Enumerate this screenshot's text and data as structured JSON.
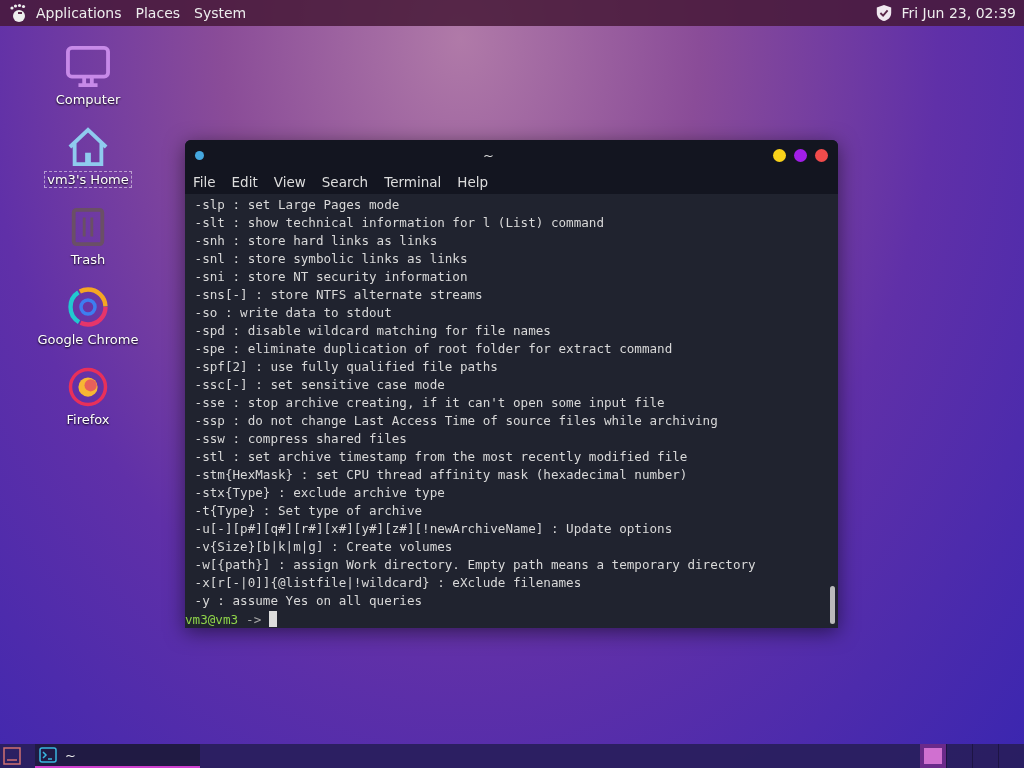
{
  "top_panel": {
    "menus": [
      "Applications",
      "Places",
      "System"
    ],
    "clock": "Fri Jun 23, 02:39"
  },
  "desktop_icons": [
    {
      "kind": "computer",
      "label": "Computer",
      "selected": false
    },
    {
      "kind": "home",
      "label": "vm3's Home",
      "selected": true
    },
    {
      "kind": "trash",
      "label": "Trash",
      "selected": false
    },
    {
      "kind": "chrome",
      "label": "Google Chrome",
      "selected": false
    },
    {
      "kind": "firefox",
      "label": "Firefox",
      "selected": false
    }
  ],
  "terminal": {
    "title": "~",
    "menu": [
      "File",
      "Edit",
      "View",
      "Search",
      "Terminal",
      "Help"
    ],
    "lines": [
      " -slp : set Large Pages mode",
      " -slt : show technical information for l (List) command",
      " -snh : store hard links as links",
      " -snl : store symbolic links as links",
      " -sni : store NT security information",
      " -sns[-] : store NTFS alternate streams",
      " -so : write data to stdout",
      " -spd : disable wildcard matching for file names",
      " -spe : eliminate duplication of root folder for extract command",
      " -spf[2] : use fully qualified file paths",
      " -ssc[-] : set sensitive case mode",
      " -sse : stop archive creating, if it can't open some input file",
      " -ssp : do not change Last Access Time of source files while archiving",
      " -ssw : compress shared files",
      " -stl : set archive timestamp from the most recently modified file",
      " -stm{HexMask} : set CPU thread affinity mask (hexadecimal number)",
      " -stx{Type} : exclude archive type",
      " -t{Type} : Set type of archive",
      " -u[-][p#][q#][r#][x#][y#][z#][!newArchiveName] : Update options",
      " -v{Size}[b|k|m|g] : Create volumes",
      " -w[{path}] : assign Work directory. Empty path means a temporary directory",
      " -x[r[-|0]]{@listfile|!wildcard} : eXclude filenames",
      " -y : assume Yes on all queries"
    ],
    "prompt_user": "vm3@vm3",
    "prompt_arrow": "->"
  },
  "taskbar": {
    "tasks": [
      {
        "label": "~",
        "selected": true
      }
    ],
    "workspaces": [
      {
        "selected": true
      },
      {
        "selected": false
      },
      {
        "selected": false
      },
      {
        "selected": false
      }
    ]
  }
}
